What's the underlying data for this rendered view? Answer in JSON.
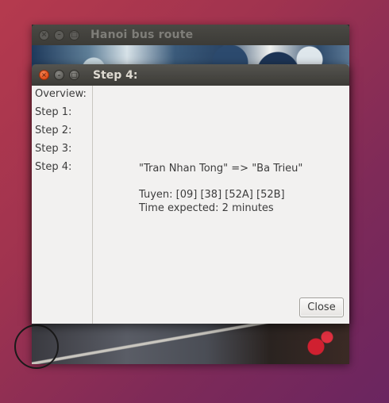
{
  "back_window": {
    "title": "Hanoi bus route"
  },
  "dialog": {
    "title": "Step 4:",
    "sidebar": {
      "items": [
        {
          "label": "Overview:"
        },
        {
          "label": "Step 1:"
        },
        {
          "label": "Step 2:"
        },
        {
          "label": "Step 3:"
        },
        {
          "label": "Step 4:"
        }
      ]
    },
    "content": {
      "route": "\"Tran Nhan Tong\" => \"Ba Trieu\"",
      "lines": "Tuyen: [09] [38] [52A] [52B]",
      "time": "Time expected: 2 minutes"
    },
    "close_label": "Close"
  },
  "icons": {
    "close": "close-icon",
    "minimize": "minimize-icon",
    "maximize": "maximize-icon"
  },
  "colors": {
    "close_button": "#e2521d",
    "titlebar": "#3c3b37",
    "dialog_bg": "#f2f1f0"
  }
}
